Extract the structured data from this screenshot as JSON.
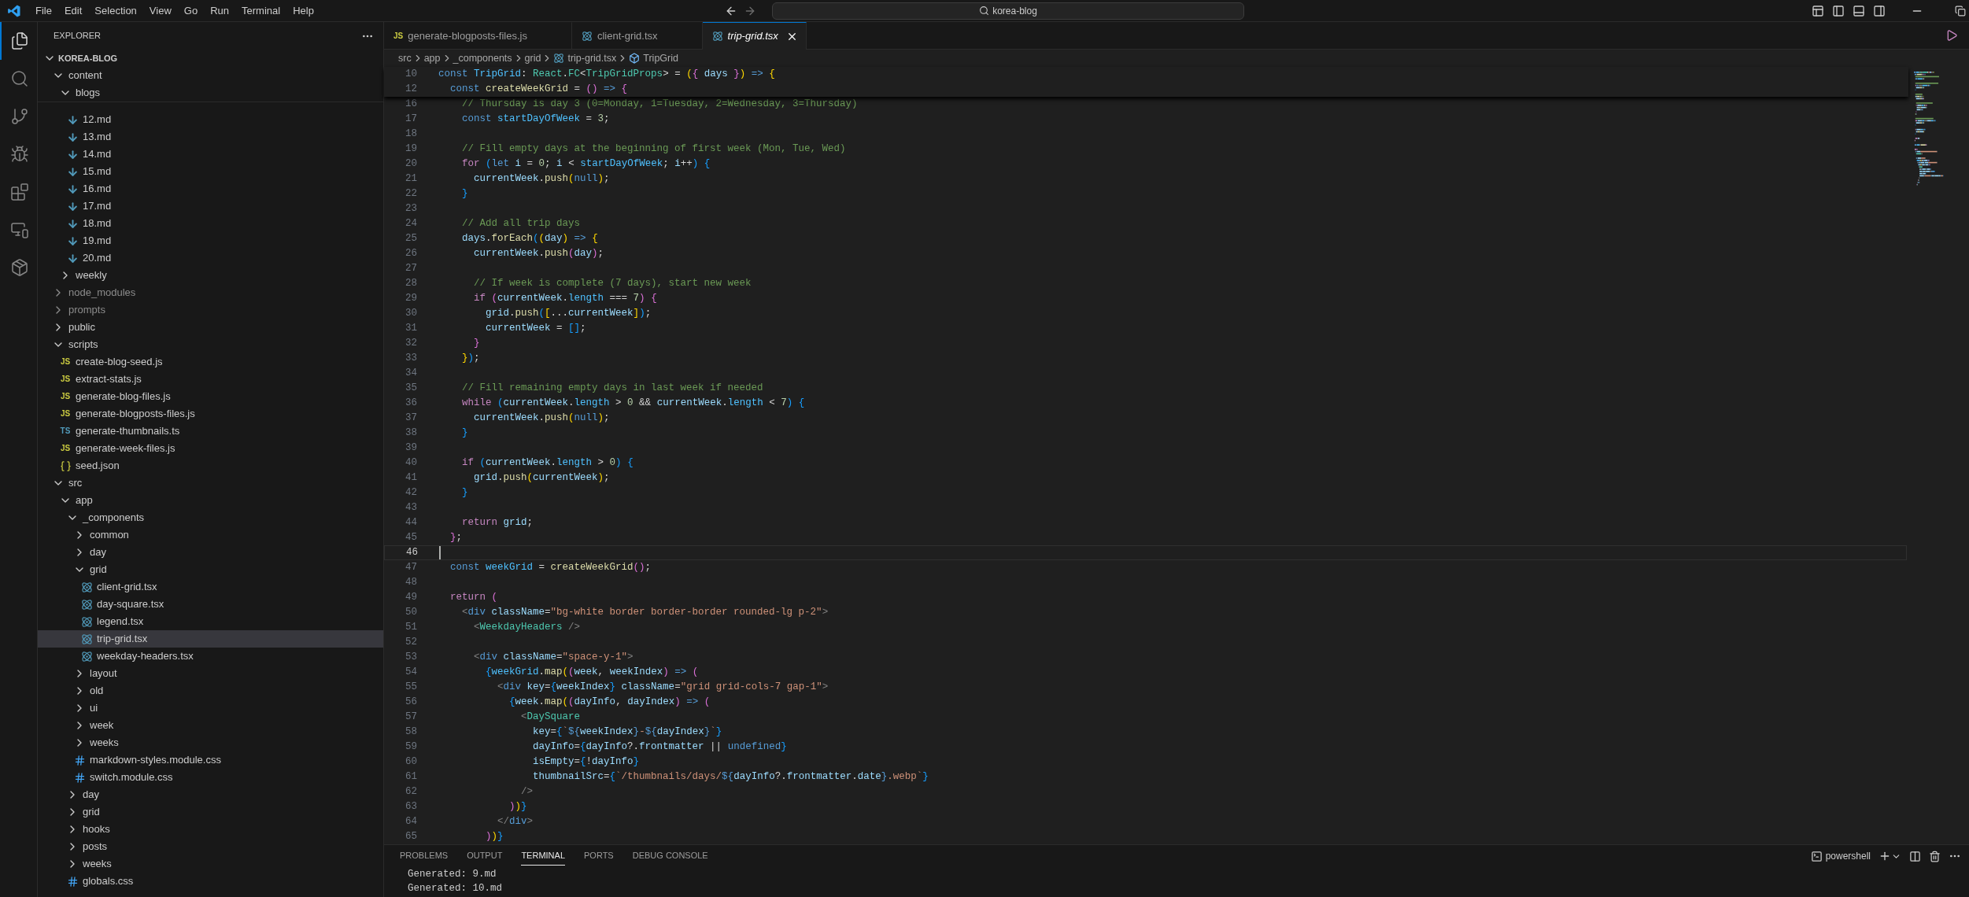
{
  "title_bar": {
    "menu": [
      "File",
      "Edit",
      "Selection",
      "View",
      "Go",
      "Run",
      "Terminal",
      "Help"
    ],
    "search": "korea-blog"
  },
  "activity_bar": [
    {
      "kind": "explorer",
      "selected": true
    },
    {
      "kind": "search",
      "selected": false
    },
    {
      "kind": "source-control",
      "selected": false
    },
    {
      "kind": "run-debug",
      "selected": false
    },
    {
      "kind": "extensions",
      "selected": false
    },
    {
      "kind": "remote",
      "selected": false
    },
    {
      "kind": "containers",
      "selected": false
    }
  ],
  "explorer": {
    "title": "EXPLORER",
    "root": {
      "label": "KOREA-BLOG",
      "expanded": true
    },
    "items": [
      {
        "label": "content",
        "kind": "folder",
        "expanded": true,
        "selected": false,
        "ignored": false,
        "children": [
          {
            "label": "blogs",
            "kind": "folder",
            "expanded": true,
            "selected": false,
            "ignored": false,
            "children": [
              {
                "label": "12.md",
                "kind": "md",
                "selected": false,
                "ignored": false
              },
              {
                "label": "13.md",
                "kind": "md",
                "selected": false,
                "ignored": false
              },
              {
                "label": "14.md",
                "kind": "md",
                "selected": false,
                "ignored": false
              },
              {
                "label": "15.md",
                "kind": "md",
                "selected": false,
                "ignored": false
              },
              {
                "label": "16.md",
                "kind": "md",
                "selected": false,
                "ignored": false
              },
              {
                "label": "17.md",
                "kind": "md",
                "selected": false,
                "ignored": false
              },
              {
                "label": "18.md",
                "kind": "md",
                "selected": false,
                "ignored": false
              },
              {
                "label": "19.md",
                "kind": "md",
                "selected": false,
                "ignored": false
              },
              {
                "label": "20.md",
                "kind": "md",
                "selected": false,
                "ignored": false
              }
            ]
          },
          {
            "label": "weekly",
            "kind": "folder",
            "expanded": false,
            "selected": false,
            "ignored": false
          }
        ]
      },
      {
        "label": "node_modules",
        "kind": "folder",
        "expanded": false,
        "selected": false,
        "ignored": true
      },
      {
        "label": "prompts",
        "kind": "folder",
        "expanded": false,
        "selected": false,
        "ignored": true
      },
      {
        "label": "public",
        "kind": "folder",
        "expanded": false,
        "selected": false,
        "ignored": false
      },
      {
        "label": "scripts",
        "kind": "folder",
        "expanded": true,
        "selected": false,
        "ignored": false,
        "children": [
          {
            "label": "create-blog-seed.js",
            "kind": "js",
            "badge": "JS",
            "selected": false,
            "ignored": false
          },
          {
            "label": "extract-stats.js",
            "kind": "js",
            "badge": "JS",
            "selected": false,
            "ignored": false
          },
          {
            "label": "generate-blog-files.js",
            "kind": "js",
            "badge": "JS",
            "selected": false,
            "ignored": false
          },
          {
            "label": "generate-blogposts-files.js",
            "kind": "js",
            "badge": "JS",
            "selected": false,
            "ignored": false
          },
          {
            "label": "generate-thumbnails.ts",
            "kind": "ts",
            "badge": "TS",
            "selected": false,
            "ignored": false
          },
          {
            "label": "generate-week-files.js",
            "kind": "js",
            "badge": "JS",
            "selected": false,
            "ignored": false
          },
          {
            "label": "seed.json",
            "kind": "json",
            "selected": false,
            "ignored": false
          }
        ]
      },
      {
        "label": "src",
        "kind": "folder",
        "expanded": true,
        "selected": false,
        "ignored": false,
        "children": [
          {
            "label": "app",
            "kind": "folder",
            "expanded": true,
            "selected": false,
            "ignored": false,
            "children": [
              {
                "label": "_components",
                "kind": "folder",
                "expanded": true,
                "selected": false,
                "ignored": false,
                "children": [
                  {
                    "label": "common",
                    "kind": "folder",
                    "expanded": false,
                    "selected": false,
                    "ignored": false
                  },
                  {
                    "label": "day",
                    "kind": "folder",
                    "expanded": false,
                    "selected": false,
                    "ignored": false
                  },
                  {
                    "label": "grid",
                    "kind": "folder",
                    "expanded": true,
                    "selected": false,
                    "ignored": false,
                    "children": [
                      {
                        "label": "client-grid.tsx",
                        "kind": "tsx",
                        "selected": false,
                        "ignored": false
                      },
                      {
                        "label": "day-square.tsx",
                        "kind": "tsx",
                        "selected": false,
                        "ignored": false
                      },
                      {
                        "label": "legend.tsx",
                        "kind": "tsx",
                        "selected": false,
                        "ignored": false
                      },
                      {
                        "label": "trip-grid.tsx",
                        "kind": "tsx",
                        "selected": true,
                        "ignored": false
                      },
                      {
                        "label": "weekday-headers.tsx",
                        "kind": "tsx",
                        "selected": false,
                        "ignored": false
                      }
                    ]
                  },
                  {
                    "label": "layout",
                    "kind": "folder",
                    "expanded": false,
                    "selected": false,
                    "ignored": false
                  },
                  {
                    "label": "old",
                    "kind": "folder",
                    "expanded": false,
                    "selected": false,
                    "ignored": false
                  },
                  {
                    "label": "ui",
                    "kind": "folder",
                    "expanded": false,
                    "selected": false,
                    "ignored": false
                  },
                  {
                    "label": "week",
                    "kind": "folder",
                    "expanded": false,
                    "selected": false,
                    "ignored": false
                  },
                  {
                    "label": "weeks",
                    "kind": "folder",
                    "expanded": false,
                    "selected": false,
                    "ignored": false
                  },
                  {
                    "label": "markdown-styles.module.css",
                    "kind": "css",
                    "selected": false,
                    "ignored": false
                  },
                  {
                    "label": "switch.module.css",
                    "kind": "css",
                    "selected": false,
                    "ignored": false
                  }
                ]
              },
              {
                "label": "day",
                "kind": "folder",
                "expanded": false,
                "selected": false,
                "ignored": false
              },
              {
                "label": "grid",
                "kind": "folder",
                "expanded": false,
                "selected": false,
                "ignored": false
              },
              {
                "label": "hooks",
                "kind": "folder",
                "expanded": false,
                "selected": false,
                "ignored": false
              },
              {
                "label": "posts",
                "kind": "folder",
                "expanded": false,
                "selected": false,
                "ignored": false
              },
              {
                "label": "weeks",
                "kind": "folder",
                "expanded": false,
                "selected": false,
                "ignored": false
              },
              {
                "label": "globals.css",
                "kind": "css",
                "selected": false,
                "ignored": false
              }
            ]
          }
        ]
      }
    ]
  },
  "tabs": [
    {
      "label": "generate-blogposts-files.js",
      "kind": "js",
      "badge": "JS",
      "selected": false,
      "preview": false
    },
    {
      "label": "client-grid.tsx",
      "kind": "tsx",
      "selected": false,
      "preview": false
    },
    {
      "label": "trip-grid.tsx",
      "kind": "tsx",
      "selected": true,
      "preview": true
    }
  ],
  "breadcrumb": [
    {
      "label": "src",
      "kind": "folder"
    },
    {
      "label": "app",
      "kind": "folder"
    },
    {
      "label": "_components",
      "kind": "folder"
    },
    {
      "label": "grid",
      "kind": "folder"
    },
    {
      "label": "trip-grid.tsx",
      "kind": "tsx"
    },
    {
      "label": "TripGrid",
      "kind": "symbol"
    }
  ],
  "editor": {
    "sticky_lines": [
      {
        "number": "10",
        "tokens": [
          {
            "text": "const ",
            "kind": "kw"
          },
          {
            "text": "TripGrid",
            "kind": "cvar"
          },
          {
            "text": ": ",
            "kind": "p"
          },
          {
            "text": "React",
            "kind": "type"
          },
          {
            "text": ".",
            "kind": "p"
          },
          {
            "text": "FC",
            "kind": "type"
          },
          {
            "text": "<",
            "kind": "p"
          },
          {
            "text": "TripGridProps",
            "kind": "type"
          },
          {
            "text": "> = ",
            "kind": "p"
          },
          {
            "text": "(",
            "kind": "b1"
          },
          {
            "text": "{",
            "kind": "b2"
          },
          {
            "text": " days ",
            "kind": "var"
          },
          {
            "text": "}",
            "kind": "b2"
          },
          {
            "text": ")",
            "kind": "b1"
          },
          {
            "text": " =>",
            "kind": "kw"
          },
          {
            "text": " {",
            "kind": "b1"
          }
        ]
      },
      {
        "number": "12",
        "tokens": [
          {
            "text": "  const ",
            "kind": "kw"
          },
          {
            "text": "createWeekGrid",
            "kind": "fn"
          },
          {
            "text": " = ",
            "kind": "p"
          },
          {
            "text": "()",
            "kind": "b2"
          },
          {
            "text": " =>",
            "kind": "kw"
          },
          {
            "text": " {",
            "kind": "b2"
          }
        ]
      }
    ],
    "lines": [
      {
        "number": "16",
        "current": false,
        "tokens": [
          {
            "text": "    // Thursday is day 3 (0=Monday, 1=Tuesday, 2=Wednesday, 3=Thursday)",
            "kind": "cm"
          }
        ]
      },
      {
        "number": "17",
        "current": false,
        "tokens": [
          {
            "text": "    const ",
            "kind": "kw"
          },
          {
            "text": "startDayOfWeek",
            "kind": "cvar"
          },
          {
            "text": " = ",
            "kind": "p"
          },
          {
            "text": "3",
            "kind": "num"
          },
          {
            "text": ";",
            "kind": "p"
          }
        ]
      },
      {
        "number": "18",
        "current": false
      },
      {
        "number": "19",
        "current": false,
        "tokens": [
          {
            "text": "    // Fill empty days at the beginning of first week (Mon, Tue, Wed)",
            "kind": "cm"
          }
        ]
      },
      {
        "number": "20",
        "current": false,
        "tokens": [
          {
            "text": "    for ",
            "kind": "ctl"
          },
          {
            "text": "(",
            "kind": "b3"
          },
          {
            "text": "let ",
            "kind": "kw"
          },
          {
            "text": "i",
            "kind": "var"
          },
          {
            "text": " = ",
            "kind": "p"
          },
          {
            "text": "0",
            "kind": "num"
          },
          {
            "text": "; ",
            "kind": "p"
          },
          {
            "text": "i",
            "kind": "var"
          },
          {
            "text": " < ",
            "kind": "p"
          },
          {
            "text": "startDayOfWeek",
            "kind": "cvar"
          },
          {
            "text": "; ",
            "kind": "p"
          },
          {
            "text": "i",
            "kind": "var"
          },
          {
            "text": "++",
            "kind": "p"
          },
          {
            "text": ")",
            "kind": "b3"
          },
          {
            "text": " {",
            "kind": "b3"
          }
        ]
      },
      {
        "number": "21",
        "current": false,
        "tokens": [
          {
            "text": "      currentWeek",
            "kind": "var"
          },
          {
            "text": ".",
            "kind": "p"
          },
          {
            "text": "push",
            "kind": "fn"
          },
          {
            "text": "(",
            "kind": "b1"
          },
          {
            "text": "null",
            "kind": "kw"
          },
          {
            "text": ")",
            "kind": "b1"
          },
          {
            "text": ";",
            "kind": "p"
          }
        ]
      },
      {
        "number": "22",
        "current": false,
        "tokens": [
          {
            "text": "    }",
            "kind": "b3"
          }
        ]
      },
      {
        "number": "23",
        "current": false
      },
      {
        "number": "24",
        "current": false,
        "tokens": [
          {
            "text": "    // Add all trip days",
            "kind": "cm"
          }
        ]
      },
      {
        "number": "25",
        "current": false,
        "tokens": [
          {
            "text": "    days",
            "kind": "var"
          },
          {
            "text": ".",
            "kind": "p"
          },
          {
            "text": "forEach",
            "kind": "fn"
          },
          {
            "text": "(",
            "kind": "b3"
          },
          {
            "text": "(",
            "kind": "b1"
          },
          {
            "text": "day",
            "kind": "var"
          },
          {
            "text": ")",
            "kind": "b1"
          },
          {
            "text": " =>",
            "kind": "kw"
          },
          {
            "text": " {",
            "kind": "b1"
          }
        ]
      },
      {
        "number": "26",
        "current": false,
        "tokens": [
          {
            "text": "      currentWeek",
            "kind": "var"
          },
          {
            "text": ".",
            "kind": "p"
          },
          {
            "text": "push",
            "kind": "fn"
          },
          {
            "text": "(",
            "kind": "b2"
          },
          {
            "text": "day",
            "kind": "var"
          },
          {
            "text": ")",
            "kind": "b2"
          },
          {
            "text": ";",
            "kind": "p"
          }
        ]
      },
      {
        "number": "27",
        "current": false
      },
      {
        "number": "28",
        "current": false,
        "tokens": [
          {
            "text": "      // If week is complete (7 days), start new week",
            "kind": "cm"
          }
        ]
      },
      {
        "number": "29",
        "current": false,
        "tokens": [
          {
            "text": "      if ",
            "kind": "ctl"
          },
          {
            "text": "(",
            "kind": "b2"
          },
          {
            "text": "currentWeek",
            "kind": "var"
          },
          {
            "text": ".",
            "kind": "p"
          },
          {
            "text": "length",
            "kind": "cvar"
          },
          {
            "text": " === ",
            "kind": "p"
          },
          {
            "text": "7",
            "kind": "num"
          },
          {
            "text": ")",
            "kind": "b2"
          },
          {
            "text": " {",
            "kind": "b2"
          }
        ]
      },
      {
        "number": "30",
        "current": false,
        "tokens": [
          {
            "text": "        grid",
            "kind": "var"
          },
          {
            "text": ".",
            "kind": "p"
          },
          {
            "text": "push",
            "kind": "fn"
          },
          {
            "text": "(",
            "kind": "b3"
          },
          {
            "text": "[",
            "kind": "b1"
          },
          {
            "text": "...",
            "kind": "p"
          },
          {
            "text": "currentWeek",
            "kind": "var"
          },
          {
            "text": "]",
            "kind": "b1"
          },
          {
            "text": ")",
            "kind": "b3"
          },
          {
            "text": ";",
            "kind": "p"
          }
        ]
      },
      {
        "number": "31",
        "current": false,
        "tokens": [
          {
            "text": "        currentWeek",
            "kind": "var"
          },
          {
            "text": " = ",
            "kind": "p"
          },
          {
            "text": "[]",
            "kind": "b3"
          },
          {
            "text": ";",
            "kind": "p"
          }
        ]
      },
      {
        "number": "32",
        "current": false,
        "tokens": [
          {
            "text": "      }",
            "kind": "b2"
          }
        ]
      },
      {
        "number": "33",
        "current": false,
        "tokens": [
          {
            "text": "    }",
            "kind": "b1"
          },
          {
            "text": ")",
            "kind": "b3"
          },
          {
            "text": ";",
            "kind": "p"
          }
        ]
      },
      {
        "number": "34",
        "current": false
      },
      {
        "number": "35",
        "current": false,
        "tokens": [
          {
            "text": "    // Fill remaining empty days in last week if needed",
            "kind": "cm"
          }
        ]
      },
      {
        "number": "36",
        "current": false,
        "tokens": [
          {
            "text": "    while ",
            "kind": "ctl"
          },
          {
            "text": "(",
            "kind": "b3"
          },
          {
            "text": "currentWeek",
            "kind": "var"
          },
          {
            "text": ".",
            "kind": "p"
          },
          {
            "text": "length",
            "kind": "cvar"
          },
          {
            "text": " > ",
            "kind": "p"
          },
          {
            "text": "0",
            "kind": "num"
          },
          {
            "text": " && ",
            "kind": "p"
          },
          {
            "text": "currentWeek",
            "kind": "var"
          },
          {
            "text": ".",
            "kind": "p"
          },
          {
            "text": "length",
            "kind": "cvar"
          },
          {
            "text": " < ",
            "kind": "p"
          },
          {
            "text": "7",
            "kind": "num"
          },
          {
            "text": ")",
            "kind": "b3"
          },
          {
            "text": " {",
            "kind": "b3"
          }
        ]
      },
      {
        "number": "37",
        "current": false,
        "tokens": [
          {
            "text": "      currentWeek",
            "kind": "var"
          },
          {
            "text": ".",
            "kind": "p"
          },
          {
            "text": "push",
            "kind": "fn"
          },
          {
            "text": "(",
            "kind": "b1"
          },
          {
            "text": "null",
            "kind": "kw"
          },
          {
            "text": ")",
            "kind": "b1"
          },
          {
            "text": ";",
            "kind": "p"
          }
        ]
      },
      {
        "number": "38",
        "current": false,
        "tokens": [
          {
            "text": "    }",
            "kind": "b3"
          }
        ]
      },
      {
        "number": "39",
        "current": false
      },
      {
        "number": "40",
        "current": false,
        "tokens": [
          {
            "text": "    if ",
            "kind": "ctl"
          },
          {
            "text": "(",
            "kind": "b3"
          },
          {
            "text": "currentWeek",
            "kind": "var"
          },
          {
            "text": ".",
            "kind": "p"
          },
          {
            "text": "length",
            "kind": "cvar"
          },
          {
            "text": " > ",
            "kind": "p"
          },
          {
            "text": "0",
            "kind": "num"
          },
          {
            "text": ")",
            "kind": "b3"
          },
          {
            "text": " {",
            "kind": "b3"
          }
        ]
      },
      {
        "number": "41",
        "current": false,
        "tokens": [
          {
            "text": "      grid",
            "kind": "var"
          },
          {
            "text": ".",
            "kind": "p"
          },
          {
            "text": "push",
            "kind": "fn"
          },
          {
            "text": "(",
            "kind": "b1"
          },
          {
            "text": "currentWeek",
            "kind": "var"
          },
          {
            "text": ")",
            "kind": "b1"
          },
          {
            "text": ";",
            "kind": "p"
          }
        ]
      },
      {
        "number": "42",
        "current": false,
        "tokens": [
          {
            "text": "    }",
            "kind": "b3"
          }
        ]
      },
      {
        "number": "43",
        "current": false
      },
      {
        "number": "44",
        "current": false,
        "tokens": [
          {
            "text": "    return ",
            "kind": "ctl"
          },
          {
            "text": "grid",
            "kind": "var"
          },
          {
            "text": ";",
            "kind": "p"
          }
        ]
      },
      {
        "number": "45",
        "current": false,
        "tokens": [
          {
            "text": "  }",
            "kind": "b2"
          },
          {
            "text": ";",
            "kind": "p"
          }
        ]
      },
      {
        "number": "46",
        "current": true
      },
      {
        "number": "47",
        "current": false,
        "tokens": [
          {
            "text": "  const ",
            "kind": "kw"
          },
          {
            "text": "weekGrid",
            "kind": "cvar"
          },
          {
            "text": " = ",
            "kind": "p"
          },
          {
            "text": "createWeekGrid",
            "kind": "fn"
          },
          {
            "text": "()",
            "kind": "b2"
          },
          {
            "text": ";",
            "kind": "p"
          }
        ]
      },
      {
        "number": "48",
        "current": false
      },
      {
        "number": "49",
        "current": false,
        "tokens": [
          {
            "text": "  return ",
            "kind": "ctl"
          },
          {
            "text": "(",
            "kind": "b2"
          }
        ]
      },
      {
        "number": "50",
        "current": false,
        "tokens": [
          {
            "text": "    <",
            "kind": "tagp"
          },
          {
            "text": "div ",
            "kind": "kw"
          },
          {
            "text": "className",
            "kind": "attr"
          },
          {
            "text": "=",
            "kind": "p"
          },
          {
            "text": "\"bg-white border border-border rounded-lg p-2\"",
            "kind": "str"
          },
          {
            "text": ">",
            "kind": "tagp"
          }
        ]
      },
      {
        "number": "51",
        "current": false,
        "tokens": [
          {
            "text": "      <",
            "kind": "tagp"
          },
          {
            "text": "WeekdayHeaders",
            "kind": "tag"
          },
          {
            "text": " />",
            "kind": "tagp"
          }
        ]
      },
      {
        "number": "52",
        "current": false
      },
      {
        "number": "53",
        "current": false,
        "tokens": [
          {
            "text": "      <",
            "kind": "tagp"
          },
          {
            "text": "div ",
            "kind": "kw"
          },
          {
            "text": "className",
            "kind": "attr"
          },
          {
            "text": "=",
            "kind": "p"
          },
          {
            "text": "\"space-y-1\"",
            "kind": "str"
          },
          {
            "text": ">",
            "kind": "tagp"
          }
        ]
      },
      {
        "number": "54",
        "current": false,
        "tokens": [
          {
            "text": "        {",
            "kind": "b3"
          },
          {
            "text": "weekGrid",
            "kind": "cvar"
          },
          {
            "text": ".",
            "kind": "p"
          },
          {
            "text": "map",
            "kind": "fn"
          },
          {
            "text": "(",
            "kind": "b1"
          },
          {
            "text": "(",
            "kind": "b2"
          },
          {
            "text": "week",
            "kind": "var"
          },
          {
            "text": ", ",
            "kind": "p"
          },
          {
            "text": "weekIndex",
            "kind": "var"
          },
          {
            "text": ")",
            "kind": "b2"
          },
          {
            "text": " =>",
            "kind": "kw"
          },
          {
            "text": " (",
            "kind": "b2"
          }
        ]
      },
      {
        "number": "55",
        "current": false,
        "tokens": [
          {
            "text": "          <",
            "kind": "tagp"
          },
          {
            "text": "div ",
            "kind": "kw"
          },
          {
            "text": "key",
            "kind": "attr"
          },
          {
            "text": "=",
            "kind": "p"
          },
          {
            "text": "{",
            "kind": "b3"
          },
          {
            "text": "weekIndex",
            "kind": "var"
          },
          {
            "text": "}",
            "kind": "b3"
          },
          {
            "text": " className",
            "kind": "attr"
          },
          {
            "text": "=",
            "kind": "p"
          },
          {
            "text": "\"grid grid-cols-7 gap-1\"",
            "kind": "str"
          },
          {
            "text": ">",
            "kind": "tagp"
          }
        ]
      },
      {
        "number": "56",
        "current": false,
        "tokens": [
          {
            "text": "            {",
            "kind": "b3"
          },
          {
            "text": "week",
            "kind": "var"
          },
          {
            "text": ".",
            "kind": "p"
          },
          {
            "text": "map",
            "kind": "fn"
          },
          {
            "text": "(",
            "kind": "b1"
          },
          {
            "text": "(",
            "kind": "b2"
          },
          {
            "text": "dayInfo",
            "kind": "var"
          },
          {
            "text": ", ",
            "kind": "p"
          },
          {
            "text": "dayIndex",
            "kind": "var"
          },
          {
            "text": ")",
            "kind": "b2"
          },
          {
            "text": " =>",
            "kind": "kw"
          },
          {
            "text": " (",
            "kind": "b2"
          }
        ]
      },
      {
        "number": "57",
        "current": false,
        "tokens": [
          {
            "text": "              <",
            "kind": "tagp"
          },
          {
            "text": "DaySquare",
            "kind": "tag"
          }
        ]
      },
      {
        "number": "58",
        "current": false,
        "tokens": [
          {
            "text": "                key",
            "kind": "attr"
          },
          {
            "text": "=",
            "kind": "p"
          },
          {
            "text": "{",
            "kind": "b3"
          },
          {
            "text": "`",
            "kind": "str"
          },
          {
            "text": "${",
            "kind": "kw"
          },
          {
            "text": "weekIndex",
            "kind": "var"
          },
          {
            "text": "}",
            "kind": "kw"
          },
          {
            "text": "-",
            "kind": "str"
          },
          {
            "text": "${",
            "kind": "kw"
          },
          {
            "text": "dayIndex",
            "kind": "var"
          },
          {
            "text": "}",
            "kind": "kw"
          },
          {
            "text": "`",
            "kind": "str"
          },
          {
            "text": "}",
            "kind": "b3"
          }
        ]
      },
      {
        "number": "59",
        "current": false,
        "tokens": [
          {
            "text": "                dayInfo",
            "kind": "attr"
          },
          {
            "text": "=",
            "kind": "p"
          },
          {
            "text": "{",
            "kind": "b3"
          },
          {
            "text": "dayInfo",
            "kind": "var"
          },
          {
            "text": "?.",
            "kind": "p"
          },
          {
            "text": "frontmatter",
            "kind": "var"
          },
          {
            "text": " || ",
            "kind": "p"
          },
          {
            "text": "undefined",
            "kind": "kw"
          },
          {
            "text": "}",
            "kind": "b3"
          }
        ]
      },
      {
        "number": "60",
        "current": false,
        "tokens": [
          {
            "text": "                isEmpty",
            "kind": "attr"
          },
          {
            "text": "=",
            "kind": "p"
          },
          {
            "text": "{",
            "kind": "b3"
          },
          {
            "text": "!",
            "kind": "p"
          },
          {
            "text": "dayInfo",
            "kind": "var"
          },
          {
            "text": "}",
            "kind": "b3"
          }
        ]
      },
      {
        "number": "61",
        "current": false,
        "tokens": [
          {
            "text": "                thumbnailSrc",
            "kind": "attr"
          },
          {
            "text": "=",
            "kind": "p"
          },
          {
            "text": "{",
            "kind": "b3"
          },
          {
            "text": "`/thumbnails/days/",
            "kind": "str"
          },
          {
            "text": "${",
            "kind": "kw"
          },
          {
            "text": "dayInfo",
            "kind": "var"
          },
          {
            "text": "?.",
            "kind": "p"
          },
          {
            "text": "frontmatter",
            "kind": "var"
          },
          {
            "text": ".",
            "kind": "p"
          },
          {
            "text": "date",
            "kind": "var"
          },
          {
            "text": "}",
            "kind": "kw"
          },
          {
            "text": ".webp`",
            "kind": "str"
          },
          {
            "text": "}",
            "kind": "b3"
          }
        ]
      },
      {
        "number": "62",
        "current": false,
        "tokens": [
          {
            "text": "              />",
            "kind": "tagp"
          }
        ]
      },
      {
        "number": "63",
        "current": false,
        "tokens": [
          {
            "text": "            )",
            "kind": "b2"
          },
          {
            "text": ")",
            "kind": "b1"
          },
          {
            "text": "}",
            "kind": "b3"
          }
        ]
      },
      {
        "number": "64",
        "current": false,
        "tokens": [
          {
            "text": "          </",
            "kind": "tagp"
          },
          {
            "text": "div",
            "kind": "kw"
          },
          {
            "text": ">",
            "kind": "tagp"
          }
        ]
      },
      {
        "number": "65",
        "current": false,
        "tokens": [
          {
            "text": "        )",
            "kind": "b2"
          },
          {
            "text": ")",
            "kind": "b1"
          },
          {
            "text": "}",
            "kind": "b3"
          }
        ]
      }
    ]
  },
  "panel": {
    "tabs": [
      {
        "label": "PROBLEMS",
        "selected": false
      },
      {
        "label": "OUTPUT",
        "selected": false
      },
      {
        "label": "TERMINAL",
        "selected": true
      },
      {
        "label": "PORTS",
        "selected": false
      },
      {
        "label": "DEBUG CONSOLE",
        "selected": false
      }
    ],
    "terminal_profile": "powershell",
    "terminal_lines": [
      "Generated: 9.md",
      "Generated: 10.md"
    ]
  }
}
